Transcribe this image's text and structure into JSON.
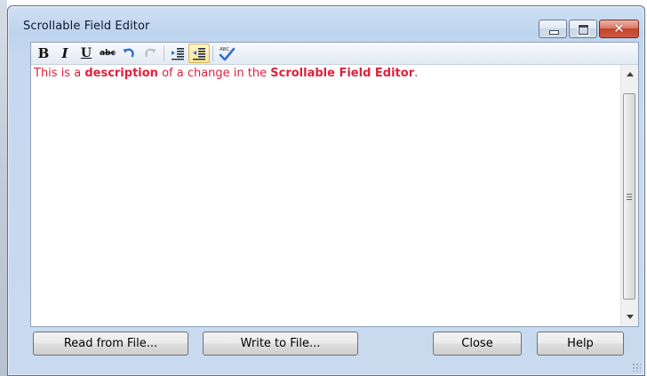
{
  "window": {
    "title": "Scrollable Field Editor",
    "accent_color": "#bed4ee",
    "close_color": "#c0422a"
  },
  "toolbar": {
    "bold": "B",
    "italic": "I",
    "underline": "U",
    "strike": "abc",
    "spell_check_label": "ABC",
    "active_button": "decrease-indent"
  },
  "editor": {
    "text_color": "#e0213d",
    "segments": [
      "This is a ",
      "description",
      " of a change in the ",
      "Scrollable Field Editor",
      "."
    ]
  },
  "buttons": {
    "read_from_file": "Read from File...",
    "write_to_file": "Write to File...",
    "close": "Close",
    "help": "Help"
  }
}
